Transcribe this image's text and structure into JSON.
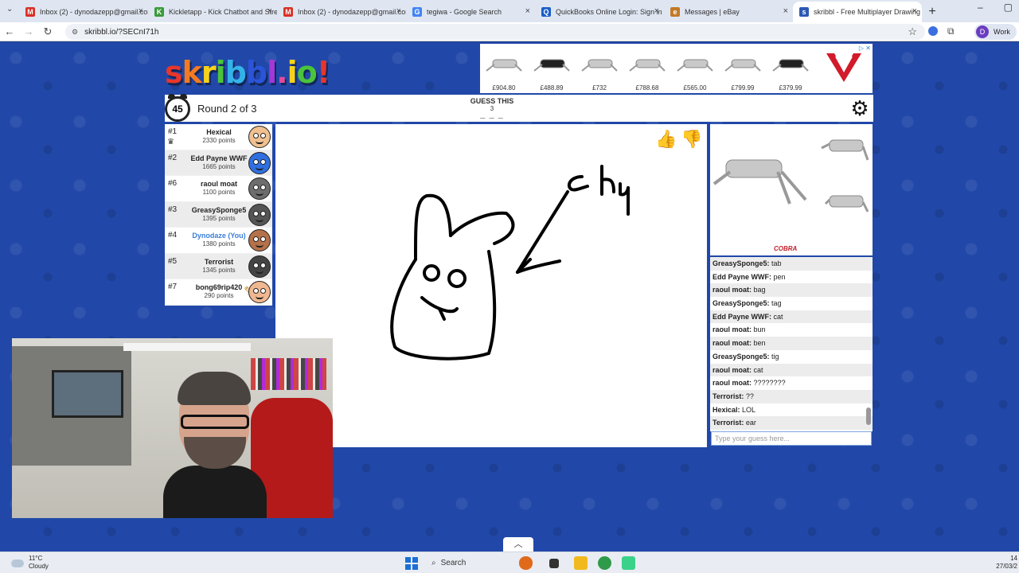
{
  "browser": {
    "tabs": [
      {
        "title": "Inbox (2) - dynodazepp@gmail.com",
        "favicon": "M",
        "color": "#d93025",
        "active": false
      },
      {
        "title": "Kickletapp - Kick Chatbot and Stream Tools",
        "favicon": "K",
        "color": "#3a9a3a",
        "active": false
      },
      {
        "title": "Inbox (2) - dynodazepp@gmail.com",
        "favicon": "M",
        "color": "#d93025",
        "active": false
      },
      {
        "title": "tegiwa - Google Search",
        "favicon": "G",
        "color": "#4285f4",
        "active": false
      },
      {
        "title": "QuickBooks Online Login: Sign in",
        "favicon": "Q",
        "color": "#1a5fc8",
        "active": false
      },
      {
        "title": "Messages | eBay",
        "favicon": "e",
        "color": "#c27a26",
        "active": false
      },
      {
        "title": "skribbl - Free Multiplayer Drawing",
        "favicon": "s",
        "color": "#2d59b5",
        "active": true
      }
    ],
    "url": "skribbl.io/?SECnI71h",
    "profile_initial": "D",
    "profile_label": "Work"
  },
  "game": {
    "logo_letters": [
      "s",
      "k",
      "r",
      "i",
      "b",
      "b",
      "l",
      ".",
      "i",
      "o",
      "!"
    ],
    "logo_colors": [
      "#e8362b",
      "#f47a21",
      "#f7d21a",
      "#4bc33a",
      "#33b2e8",
      "#2b54d8",
      "#a238d6",
      "#e54a9a",
      "#f7d21a",
      "#4bc33a",
      "#e8362b"
    ],
    "timer": "45",
    "round_text": "Round 2 of 3",
    "guess_label": "GUESS THIS",
    "guess_count": "3",
    "guess_blanks": "_ _ _",
    "players": [
      {
        "rank": "#1",
        "name": "Hexical",
        "points": "2330 points",
        "you": false,
        "crown": true,
        "avatar_color": "#f0c090"
      },
      {
        "rank": "#2",
        "name": "Edd Payne WWF",
        "points": "1665 points",
        "you": false,
        "crown": false,
        "avatar_color": "#2f6fe0"
      },
      {
        "rank": "#6",
        "name": "raoul moat",
        "points": "1100 points",
        "you": false,
        "crown": false,
        "avatar_color": "#6d6d6d"
      },
      {
        "rank": "#3",
        "name": "GreasySponge5",
        "points": "1395 points",
        "you": false,
        "crown": false,
        "avatar_color": "#555555"
      },
      {
        "rank": "#4",
        "name": "Dynodaze (You)",
        "points": "1380 points",
        "you": true,
        "crown": false,
        "avatar_color": "#b5714a"
      },
      {
        "rank": "#5",
        "name": "Terrorist",
        "points": "1345 points",
        "you": false,
        "crown": false,
        "avatar_color": "#444444"
      },
      {
        "rank": "#7",
        "name": "bong69rip420",
        "points": "290 points",
        "you": false,
        "crown": false,
        "avatar_color": "#f0b890",
        "drawing": true
      }
    ],
    "chat": [
      {
        "user": "GreasySponge5:",
        "msg": "tab"
      },
      {
        "user": "Edd Payne WWF:",
        "msg": "pen"
      },
      {
        "user": "raoul moat:",
        "msg": "bag"
      },
      {
        "user": "GreasySponge5:",
        "msg": "tag"
      },
      {
        "user": "Edd Payne WWF:",
        "msg": "cat"
      },
      {
        "user": "raoul moat:",
        "msg": "bun"
      },
      {
        "user": "raoul moat:",
        "msg": "ben"
      },
      {
        "user": "GreasySponge5:",
        "msg": "tig"
      },
      {
        "user": "raoul moat:",
        "msg": "cat"
      },
      {
        "user": "raoul moat:",
        "msg": "????????"
      },
      {
        "user": "Terrorist:",
        "msg": "??"
      },
      {
        "user": "Hexical:",
        "msg": "LOL"
      },
      {
        "user": "Terrorist:",
        "msg": "ear"
      }
    ],
    "chat_placeholder": "Type your guess here..."
  },
  "ads": {
    "top_prices": [
      "£904.80",
      "£488.89",
      "£732",
      "£788.68",
      "£565.00",
      "£799.99",
      "£379.99"
    ],
    "right_brand": "COBRA"
  },
  "taskbar": {
    "temperature": "11°C",
    "weather": "Cloudy",
    "search_label": "Search",
    "time": "14",
    "date": "27/03/2"
  }
}
